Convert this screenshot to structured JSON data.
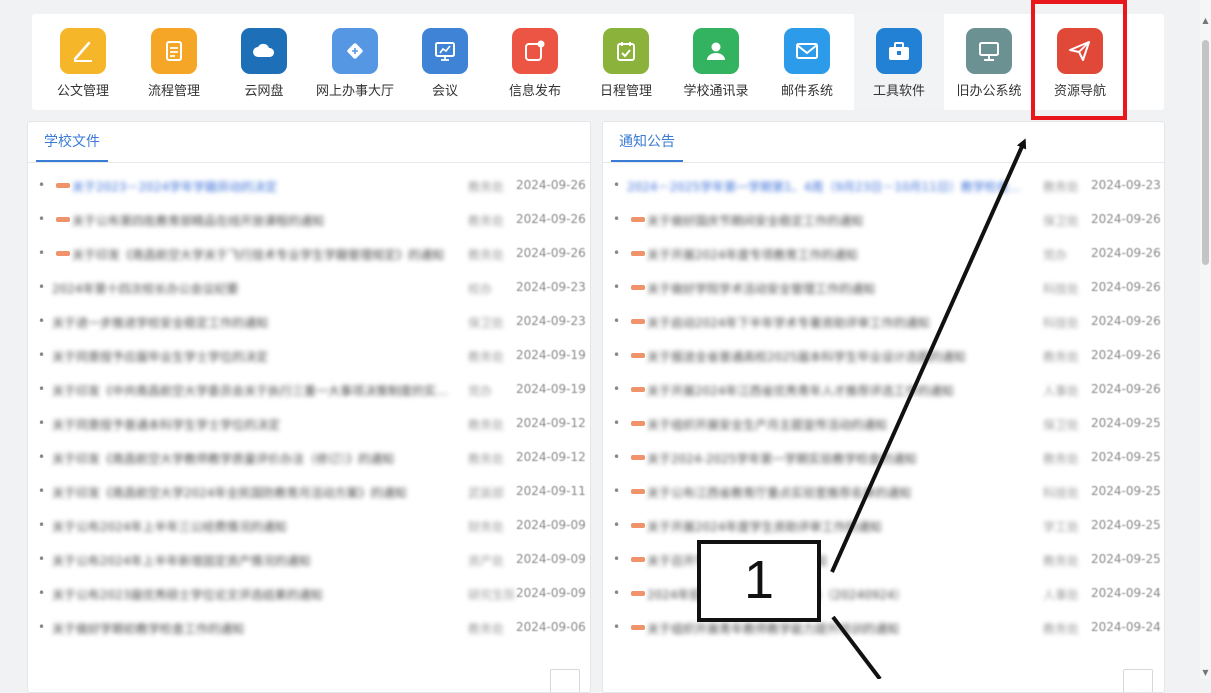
{
  "toolbar": {
    "items": [
      {
        "label": "公文管理",
        "icon": "pencil-icon",
        "color": "#f6b62a"
      },
      {
        "label": "流程管理",
        "icon": "document-icon",
        "color": "#f6a626"
      },
      {
        "label": "云网盘",
        "icon": "cloud-icon",
        "color": "#1d6fb8"
      },
      {
        "label": "网上办事大厅",
        "icon": "tag-icon",
        "color": "#5597e3"
      },
      {
        "label": "会议",
        "icon": "presentation-icon",
        "color": "#3e83d6"
      },
      {
        "label": "信息发布",
        "icon": "notification-icon",
        "color": "#ec5444"
      },
      {
        "label": "日程管理",
        "icon": "calendar-check-icon",
        "color": "#8bb33b"
      },
      {
        "label": "学校通讯录",
        "icon": "contact-icon",
        "color": "#33b25f"
      },
      {
        "label": "邮件系统",
        "icon": "mail-icon",
        "color": "#2c9bea"
      },
      {
        "label": "工具软件",
        "icon": "toolbox-icon",
        "color": "#2281d4"
      },
      {
        "label": "旧办公系统",
        "icon": "monitor-icon",
        "color": "#6c9192"
      },
      {
        "label": "资源导航",
        "icon": "paper-plane-icon",
        "color": "#e04838"
      }
    ]
  },
  "school_docs": {
    "tab_label": "学校文件",
    "rows": [
      {
        "title": "关于2023－2024学年学籍异动的决定",
        "dept": "教务处",
        "date": "2024-09-26",
        "tag": true,
        "blue": true
      },
      {
        "title": "关于公布第四批教育部精品在线开放课程的通知",
        "dept": "教务处",
        "date": "2024-09-26",
        "tag": true,
        "blue": false
      },
      {
        "title": "关于印发《南昌航空大学关于飞行技术专业学生学籍管理规定》的通知",
        "dept": "教务处",
        "date": "2024-09-26",
        "tag": true,
        "blue": false
      },
      {
        "title": "2024年第十四次校长办公会议纪要",
        "dept": "校办",
        "date": "2024-09-23",
        "tag": false,
        "blue": false
      },
      {
        "title": "关于进一步推进学校安全稳定工作的通知",
        "dept": "保卫处",
        "date": "2024-09-23",
        "tag": false,
        "blue": false
      },
      {
        "title": "关于同意授予应届毕业生学士学位的决定",
        "dept": "教务处",
        "date": "2024-09-19",
        "tag": false,
        "blue": false
      },
      {
        "title": "关于印发《中共南昌航空大学委员会关于执行三重一大事项决策制度的实施办法》的通知",
        "dept": "党办",
        "date": "2024-09-19",
        "tag": false,
        "blue": false
      },
      {
        "title": "关于同意授予普通本科学生学士学位的决定",
        "dept": "教务处",
        "date": "2024-09-12",
        "tag": false,
        "blue": false
      },
      {
        "title": "关于印发《南昌航空大学教师教学质量评价办法（修订）》的通知",
        "dept": "教务处",
        "date": "2024-09-12",
        "tag": false,
        "blue": false
      },
      {
        "title": "关于印发《南昌航空大学2024年全民国防教育月活动方案》的通知",
        "dept": "武装部",
        "date": "2024-09-11",
        "tag": false,
        "blue": false
      },
      {
        "title": "关于公布2024年上半年三公经费情况的通知",
        "dept": "财务处",
        "date": "2024-09-09",
        "tag": false,
        "blue": false
      },
      {
        "title": "关于公布2024年上半年新增固定资产情况的通知",
        "dept": "资产处",
        "date": "2024-09-09",
        "tag": false,
        "blue": false
      },
      {
        "title": "关于公布2023届优秀硕士学位论文评选结果的通知",
        "dept": "研究生院",
        "date": "2024-09-09",
        "tag": false,
        "blue": false
      },
      {
        "title": "关于做好学期初教学检查工作的通知",
        "dept": "教务处",
        "date": "2024-09-06",
        "tag": false,
        "blue": false
      }
    ]
  },
  "notices": {
    "tab_label": "通知公告",
    "rows": [
      {
        "title": "2024－2025学年第一学期第1、4周（9月23日－10月11日）教学检查安排",
        "dept": "教务处",
        "date": "2024-09-23",
        "tag": false,
        "blue": true
      },
      {
        "title": "关于做好国庆节期间安全稳定工作的通知",
        "dept": "保卫处",
        "date": "2024-09-26",
        "tag": true,
        "blue": false
      },
      {
        "title": "关于开展2024年度专项教育工作的通知",
        "dept": "党办",
        "date": "2024-09-26",
        "tag": true,
        "blue": false
      },
      {
        "title": "关于做好学院学术活动安全管理工作的通知",
        "dept": "科技处",
        "date": "2024-09-26",
        "tag": true,
        "blue": false
      },
      {
        "title": "关于启动2024年下半年学术专著资助评审工作的通知",
        "dept": "科技处",
        "date": "2024-09-26",
        "tag": true,
        "blue": false
      },
      {
        "title": "关于报送全省普通高校2025届本科学生毕业设计选题的通知",
        "dept": "教务处",
        "date": "2024-09-26",
        "tag": true,
        "blue": false
      },
      {
        "title": "关于开展2024年江西省优秀青年人才推荐评选工作的通知",
        "dept": "人事处",
        "date": "2024-09-26",
        "tag": true,
        "blue": false
      },
      {
        "title": "关于组织开展安全生产月主题宣传活动的通知",
        "dept": "保卫处",
        "date": "2024-09-25",
        "tag": true,
        "blue": false
      },
      {
        "title": "关于2024-2025学年第一学期实验教学检查的通知",
        "dept": "教务处",
        "date": "2024-09-25",
        "tag": true,
        "blue": false
      },
      {
        "title": "关于公布江西省教育厅重点实验室推荐名单的通知",
        "dept": "科技处",
        "date": "2024-09-25",
        "tag": true,
        "blue": false
      },
      {
        "title": "关于开展2024年度学生资助评审工作的通知",
        "dept": "学工处",
        "date": "2024-09-25",
        "tag": true,
        "blue": false
      },
      {
        "title": "关于召开学校教学工作会议的通知",
        "dept": "教务处",
        "date": "2024-09-25",
        "tag": true,
        "blue": false
      },
      {
        "title": "2024年招聘高层次人才博士公告（20240924）",
        "dept": "人事处",
        "date": "2024-09-24",
        "tag": true,
        "blue": false
      },
      {
        "title": "关于组织开展青年教师教学能力提升培训的通知",
        "dept": "教务处",
        "date": "2024-09-24",
        "tag": true,
        "blue": false
      }
    ]
  },
  "annotation": {
    "callout_number": "1"
  }
}
